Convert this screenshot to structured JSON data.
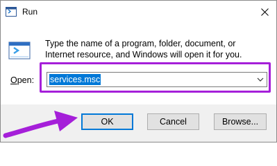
{
  "window": {
    "title": "Run",
    "close_icon": "close-icon",
    "app_icon": "run-app-icon"
  },
  "body": {
    "description": "Type the name of a program, folder, document, or Internet resource, and Windows will open it for you."
  },
  "open_field": {
    "label_prefix": "",
    "label_access_key": "O",
    "label_rest": "pen:",
    "value": "services.msc"
  },
  "buttons": {
    "ok": "OK",
    "cancel": "Cancel",
    "browse": "Browse..."
  },
  "annotation": {
    "highlight_color": "#a51fd9",
    "arrow_color": "#a51fd9"
  }
}
